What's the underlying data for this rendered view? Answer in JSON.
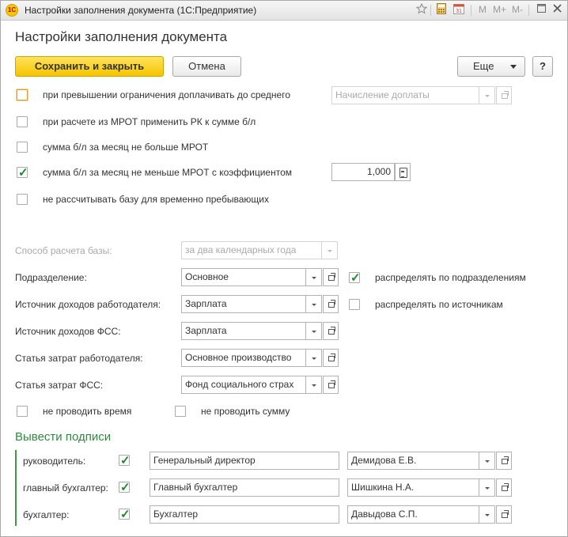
{
  "window": {
    "title": "Настройки заполнения документа  (1С:Предприятие)",
    "app_icon": "1С",
    "memory_buttons": [
      "M",
      "M+",
      "M-"
    ]
  },
  "page_title": "Настройки заполнения документа",
  "toolbar": {
    "save_close_label": "Сохранить и закрыть",
    "cancel_label": "Отмена",
    "more_label": "Еще",
    "help_label": "?"
  },
  "options": [
    {
      "label": "при превышении ограничения  доплачивать до среднего",
      "checked": false
    },
    {
      "label": "при расчете из МРОТ применить РК к сумме б/л",
      "checked": false
    },
    {
      "label": "сумма б/л за месяц не больше МРОТ",
      "checked": false
    },
    {
      "label": "сумма б/л за месяц не меньше МРОТ с коэффициентом",
      "checked": true
    },
    {
      "label": "не рассчитывать базу для временно пребывающих",
      "checked": false
    }
  ],
  "surcharge_field": {
    "placeholder": "Начисление доплаты",
    "value": ""
  },
  "coefficient_value": "1,000",
  "base_method": {
    "label": "Способ расчета базы:",
    "value": "за два календарных года"
  },
  "department": {
    "label": "Подразделение:",
    "value": "Основное",
    "option_label": "распределять по подразделениям",
    "option_checked": true
  },
  "employer_income_source": {
    "label": "Источник доходов работодателя:",
    "value": "Зарплата",
    "option_label": "распределять по источникам",
    "option_checked": false
  },
  "fss_income_source": {
    "label": "Источник доходов ФСС:",
    "value": "Зарплата"
  },
  "employer_cost_item": {
    "label": "Статья затрат работодателя:",
    "value": "Основное производство"
  },
  "fss_cost_item": {
    "label": "Статья затрат ФСС:",
    "value": "Фонд социального страх"
  },
  "no_time": {
    "label": "не проводить время",
    "checked": false
  },
  "no_sum": {
    "label": "не проводить сумму",
    "checked": false
  },
  "signatures": {
    "title": "Вывести подписи",
    "rows": [
      {
        "role": "руководитель:",
        "checked": true,
        "position": "Генеральный директор",
        "person": "Демидова Е.В."
      },
      {
        "role": "главный бухгалтер:",
        "checked": true,
        "position": "Главный бухгалтер",
        "person": "Шишкина Н.А."
      },
      {
        "role": "бухгалтер:",
        "checked": true,
        "position": "Бухгалтер",
        "person": "Давыдова С.П."
      }
    ]
  }
}
